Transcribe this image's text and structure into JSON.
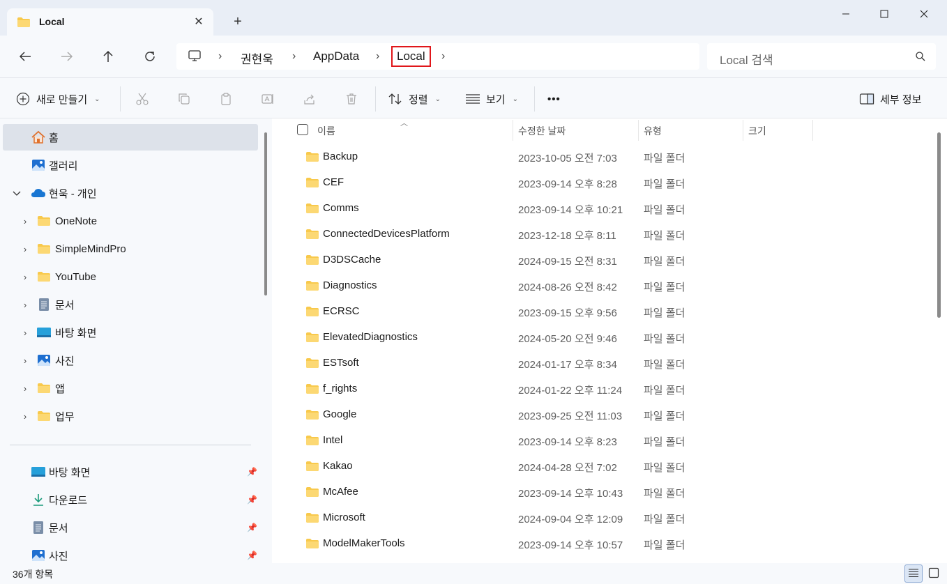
{
  "tab": {
    "title": "Local",
    "close": "✕",
    "new": "+"
  },
  "window": {
    "minimize": "—",
    "maximize": "☐",
    "close": "✕"
  },
  "breadcrumb": {
    "items": [
      "권현욱",
      "AppData",
      "Local"
    ],
    "separator": "›"
  },
  "search": {
    "placeholder": "Local 검색"
  },
  "toolbar": {
    "new_label": "새로 만들기",
    "sort_label": "정렬",
    "view_label": "보기",
    "more_label": "•••",
    "details_label": "세부 정보",
    "dropdown_glyph": "⌄"
  },
  "sidebar": {
    "items": [
      {
        "label": "홈",
        "icon": "home-icon",
        "selected": true
      },
      {
        "label": "갤러리",
        "icon": "gallery-icon"
      },
      {
        "label": "현욱 - 개인",
        "icon": "onedrive-icon",
        "expanded": true
      },
      {
        "label": "OneNote",
        "icon": "folder-icon"
      },
      {
        "label": "SimpleMindPro",
        "icon": "folder-icon"
      },
      {
        "label": "YouTube",
        "icon": "folder-icon"
      },
      {
        "label": "문서",
        "icon": "documents-icon"
      },
      {
        "label": "바탕 화면",
        "icon": "desktop-icon"
      },
      {
        "label": "사진",
        "icon": "pictures-icon"
      },
      {
        "label": "앱",
        "icon": "folder-icon"
      },
      {
        "label": "업무",
        "icon": "folder-icon"
      }
    ],
    "pinned": [
      {
        "label": "바탕 화면",
        "icon": "desktop-icon"
      },
      {
        "label": "다운로드",
        "icon": "download-icon"
      },
      {
        "label": "문서",
        "icon": "documents-icon"
      },
      {
        "label": "사진",
        "icon": "pictures-icon"
      }
    ]
  },
  "columns": {
    "name": "이름",
    "date": "수정한 날짜",
    "type": "유형",
    "size": "크기"
  },
  "files": [
    {
      "name": "Backup",
      "date": "2023-10-05 오전 7:03",
      "type": "파일 폴더"
    },
    {
      "name": "CEF",
      "date": "2023-09-14 오후 8:28",
      "type": "파일 폴더"
    },
    {
      "name": "Comms",
      "date": "2023-09-14 오후 10:21",
      "type": "파일 폴더"
    },
    {
      "name": "ConnectedDevicesPlatform",
      "date": "2023-12-18 오후 8:11",
      "type": "파일 폴더"
    },
    {
      "name": "D3DSCache",
      "date": "2024-09-15 오전 8:31",
      "type": "파일 폴더"
    },
    {
      "name": "Diagnostics",
      "date": "2024-08-26 오전 8:42",
      "type": "파일 폴더"
    },
    {
      "name": "ECRSC",
      "date": "2023-09-15 오후 9:56",
      "type": "파일 폴더"
    },
    {
      "name": "ElevatedDiagnostics",
      "date": "2024-05-20 오전 9:46",
      "type": "파일 폴더"
    },
    {
      "name": "ESTsoft",
      "date": "2024-01-17 오후 8:34",
      "type": "파일 폴더"
    },
    {
      "name": "f_rights",
      "date": "2024-01-22 오후 11:24",
      "type": "파일 폴더"
    },
    {
      "name": "Google",
      "date": "2023-09-25 오전 11:03",
      "type": "파일 폴더"
    },
    {
      "name": "Intel",
      "date": "2023-09-14 오후 8:23",
      "type": "파일 폴더"
    },
    {
      "name": "Kakao",
      "date": "2024-04-28 오전 7:02",
      "type": "파일 폴더"
    },
    {
      "name": "McAfee",
      "date": "2023-09-14 오후 10:43",
      "type": "파일 폴더"
    },
    {
      "name": "Microsoft",
      "date": "2024-09-04 오후 12:09",
      "type": "파일 폴더"
    },
    {
      "name": "ModelMakerTools",
      "date": "2023-09-14 오후 10:57",
      "type": "파일 폴더"
    }
  ],
  "status": {
    "count": "36개 항목"
  },
  "colors": {
    "folder": "#f8c94c",
    "highlight_border": "#e0161a",
    "selected_bg": "#dde2ea"
  }
}
